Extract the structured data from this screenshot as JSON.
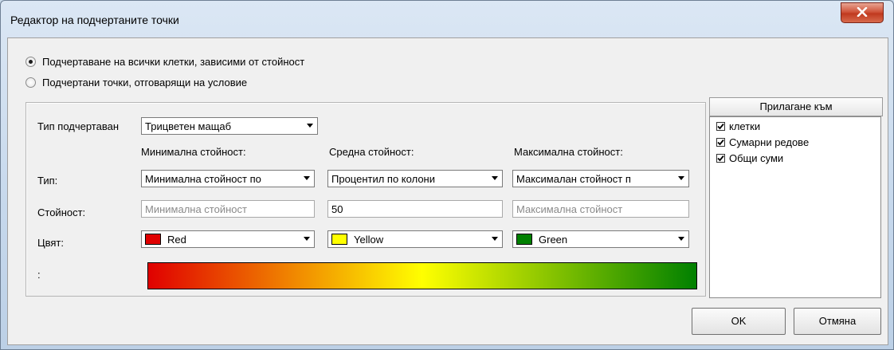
{
  "window": {
    "title": "Редактор на подчертаните точки",
    "close_icon": "close-icon"
  },
  "mode": {
    "option_all": "Подчертаване на всички клетки, зависими от стойност",
    "option_condition": "Подчертани точки, отговарящи на условие",
    "selected": "all"
  },
  "format": {
    "type_label": "Тип подчертаван",
    "type_value": "Трицветен мащаб",
    "row_labels": {
      "type": "Тип:",
      "value": "Стойност:",
      "color": "Цвят:",
      "preview": ":"
    },
    "columns": [
      {
        "header": "Минимална стойност:",
        "type": "Минимална стойност по",
        "value": "",
        "placeholder": "Минимална стойност",
        "color_name": "Red",
        "color": "#e00000"
      },
      {
        "header": "Средна стойност:",
        "type": "Процентил по колони",
        "value": "50",
        "placeholder": "",
        "color_name": "Yellow",
        "color": "#ffff00"
      },
      {
        "header": "Максимална стойност:",
        "type": "Максималан стойност п",
        "value": "",
        "placeholder": "Максимална стойност",
        "color_name": "Green",
        "color": "#008000"
      }
    ]
  },
  "apply_to": {
    "header": "Прилагане към",
    "items": [
      {
        "label": "клетки",
        "checked": true
      },
      {
        "label": "Сумарни редове",
        "checked": true
      },
      {
        "label": "Общи суми",
        "checked": true
      }
    ]
  },
  "buttons": {
    "ok": "OK",
    "cancel": "Отмяна"
  }
}
